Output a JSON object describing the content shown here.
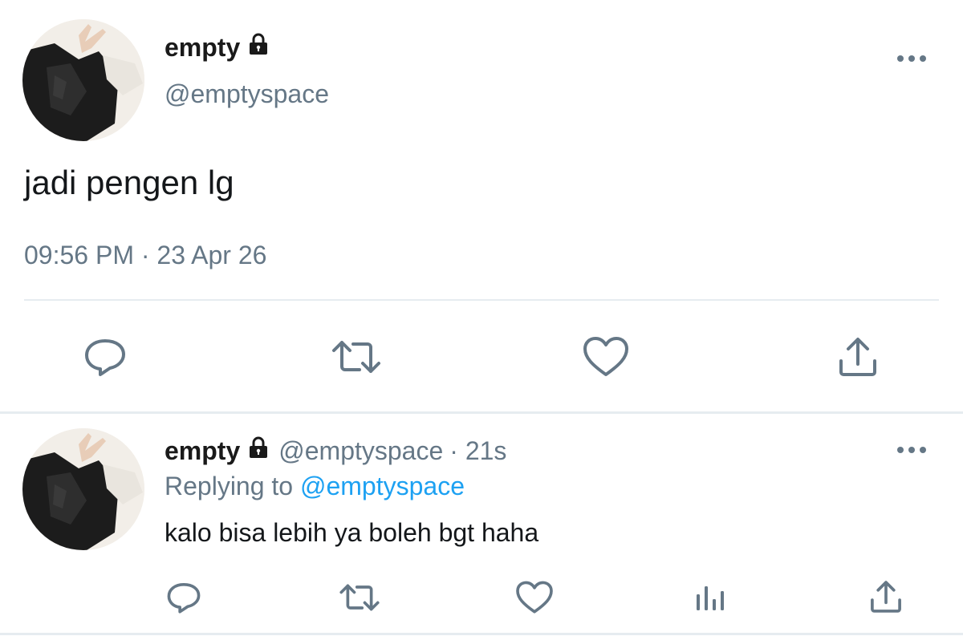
{
  "tweet": {
    "display_name": "empty",
    "handle": "@emptyspace",
    "text": "jadi pengen lg",
    "timestamp": "09:56 PM · 23 Apr 26",
    "actions": [
      "reply-icon",
      "retweet-icon",
      "like-icon",
      "share-icon"
    ],
    "more_icon": "more-icon",
    "locked_icon": "lock-icon"
  },
  "reply": {
    "display_name": "empty",
    "handle": "@emptyspace",
    "time_ago": "· 21s",
    "replying_prefix": "Replying to",
    "replying_to": "@emptyspace",
    "text": "kalo bisa lebih ya boleh bgt haha",
    "actions": [
      "reply-icon",
      "retweet-icon",
      "like-icon",
      "analytics-icon",
      "share-icon"
    ]
  },
  "colors": {
    "text": "#14171a",
    "muted": "#657786",
    "link": "#1da1f2",
    "divider": "#e6ecf0"
  }
}
